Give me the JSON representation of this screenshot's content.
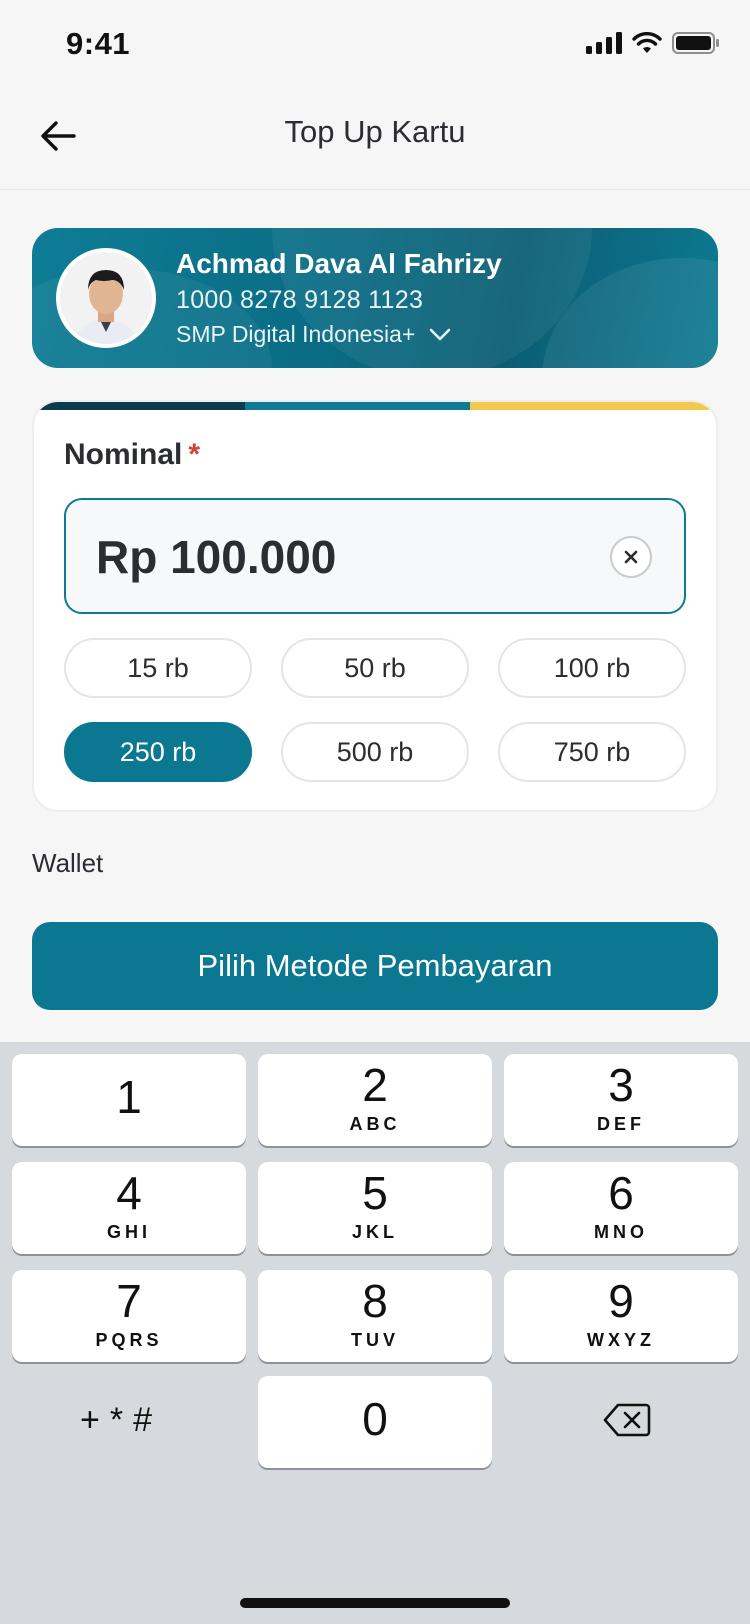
{
  "status_bar": {
    "time": "9:41"
  },
  "nav": {
    "title": "Top Up Kartu",
    "back_icon": "arrow-left-icon"
  },
  "profile": {
    "name": "Achmad Dava Al Fahrizy",
    "card_number": "1000 8278 9128 1123",
    "school": "SMP Digital Indonesia+",
    "expand_icon": "chevron-down-icon"
  },
  "nominal": {
    "label": "Nominal",
    "required_mark": "*",
    "amount": "Rp 100.000",
    "clear_icon": "close-icon",
    "chips": [
      {
        "label": "15 rb",
        "selected": false
      },
      {
        "label": "50 rb",
        "selected": false
      },
      {
        "label": "100 rb",
        "selected": false
      },
      {
        "label": "250 rb",
        "selected": true
      },
      {
        "label": "500 rb",
        "selected": false
      },
      {
        "label": "750 rb",
        "selected": false
      }
    ]
  },
  "wallet_label": "Wallet",
  "pay_button": "Pilih Metode Pembayaran",
  "keyboard": {
    "keys": [
      {
        "digit": "1",
        "letters": ""
      },
      {
        "digit": "2",
        "letters": "ABC"
      },
      {
        "digit": "3",
        "letters": "DEF"
      },
      {
        "digit": "4",
        "letters": "GHI"
      },
      {
        "digit": "5",
        "letters": "JKL"
      },
      {
        "digit": "6",
        "letters": "MNO"
      },
      {
        "digit": "7",
        "letters": "PQRS"
      },
      {
        "digit": "8",
        "letters": "TUV"
      },
      {
        "digit": "9",
        "letters": "WXYZ"
      },
      {
        "digit": "0",
        "letters": ""
      }
    ],
    "symbols": "+*#",
    "delete_icon": "backspace-icon"
  },
  "colors": {
    "accent": "#0b7791",
    "stripe": [
      "#0b3b4c",
      "#0e7a93",
      "#f2c94c"
    ],
    "required": "#d0452f"
  }
}
